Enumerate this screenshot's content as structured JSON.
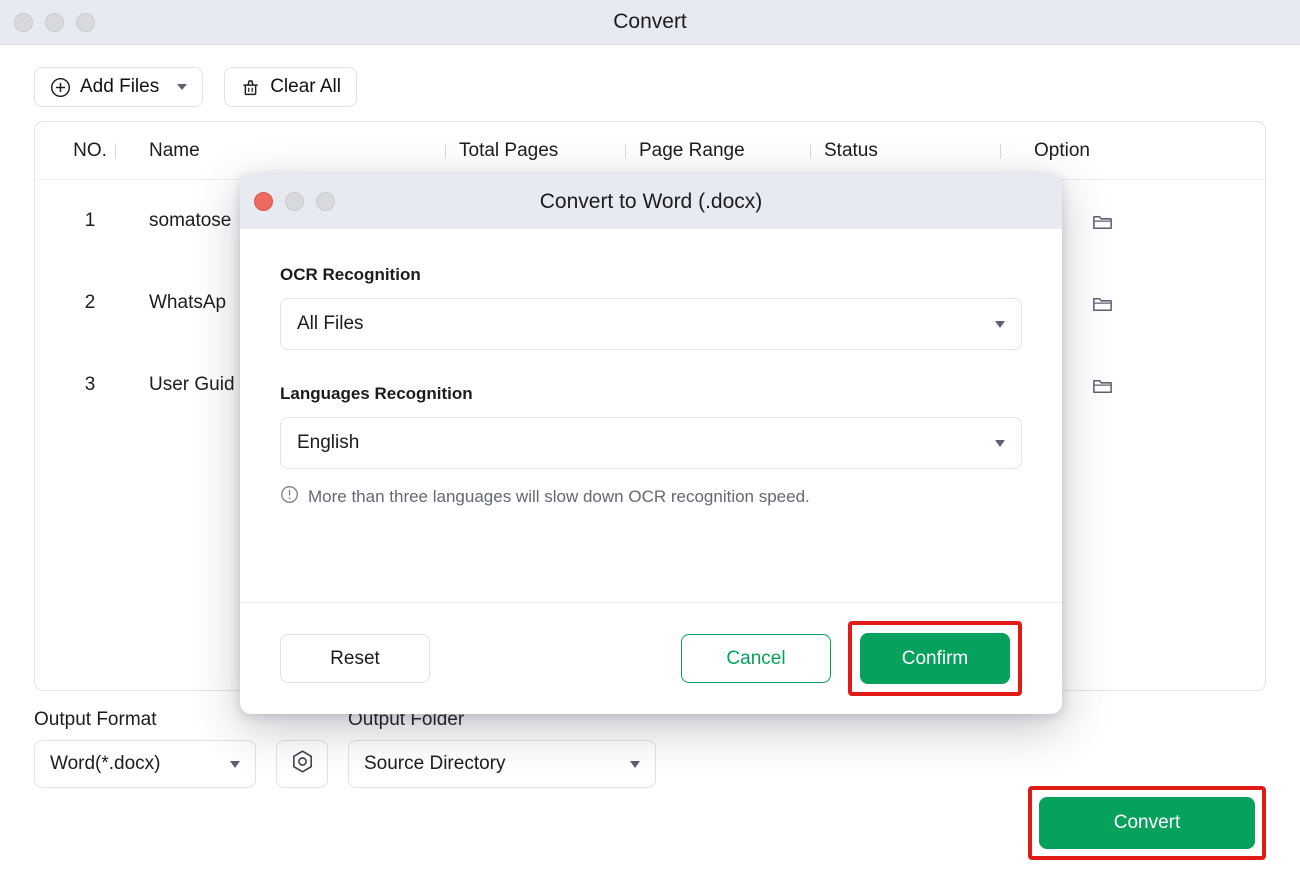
{
  "window": {
    "title": "Convert",
    "traffic_lights": [
      "close",
      "minimize",
      "maximize"
    ]
  },
  "toolbar": {
    "add_files_label": "Add Files",
    "add_files_icon": "plus-circle-icon",
    "clear_all_label": "Clear All",
    "clear_all_icon": "trash-icon"
  },
  "file_table": {
    "columns": [
      {
        "key": "no",
        "label": "NO."
      },
      {
        "key": "name",
        "label": "Name"
      },
      {
        "key": "total_pages",
        "label": "Total Pages"
      },
      {
        "key": "page_range",
        "label": "Page Range"
      },
      {
        "key": "status",
        "label": "Status"
      },
      {
        "key": "option",
        "label": "Option"
      }
    ],
    "rows": [
      {
        "no": "1",
        "name": "somatose",
        "remove_icon": "close-icon",
        "folder_icon": "folder-icon"
      },
      {
        "no": "2",
        "name": "WhatsAp",
        "remove_icon": "close-icon",
        "folder_icon": "folder-icon"
      },
      {
        "no": "3",
        "name": "User Guid",
        "remove_icon": "close-icon",
        "folder_icon": "folder-icon"
      }
    ]
  },
  "bottom_bar": {
    "output_format_label": "Output Format",
    "output_format_value": "Word(*.docx)",
    "settings_icon": "hex-settings-icon",
    "output_folder_label": "Output Folder",
    "output_folder_value": "Source Directory",
    "convert_label": "Convert"
  },
  "modal": {
    "title": "Convert to Word (.docx)",
    "traffic_lights": [
      "close",
      "minimize",
      "maximize"
    ],
    "ocr_label": "OCR Recognition",
    "ocr_value": "All Files",
    "languages_label": "Languages Recognition",
    "languages_value": "English",
    "hint_icon": "warning-circle-icon",
    "hint_text": "More than three languages will slow down OCR recognition speed.",
    "reset_label": "Reset",
    "cancel_label": "Cancel",
    "confirm_label": "Confirm"
  },
  "colors": {
    "accent_green": "#06a15c",
    "highlight_red": "#e01b16",
    "titlebar": "#e8eaf1",
    "close_light": "#ec6a5e"
  }
}
